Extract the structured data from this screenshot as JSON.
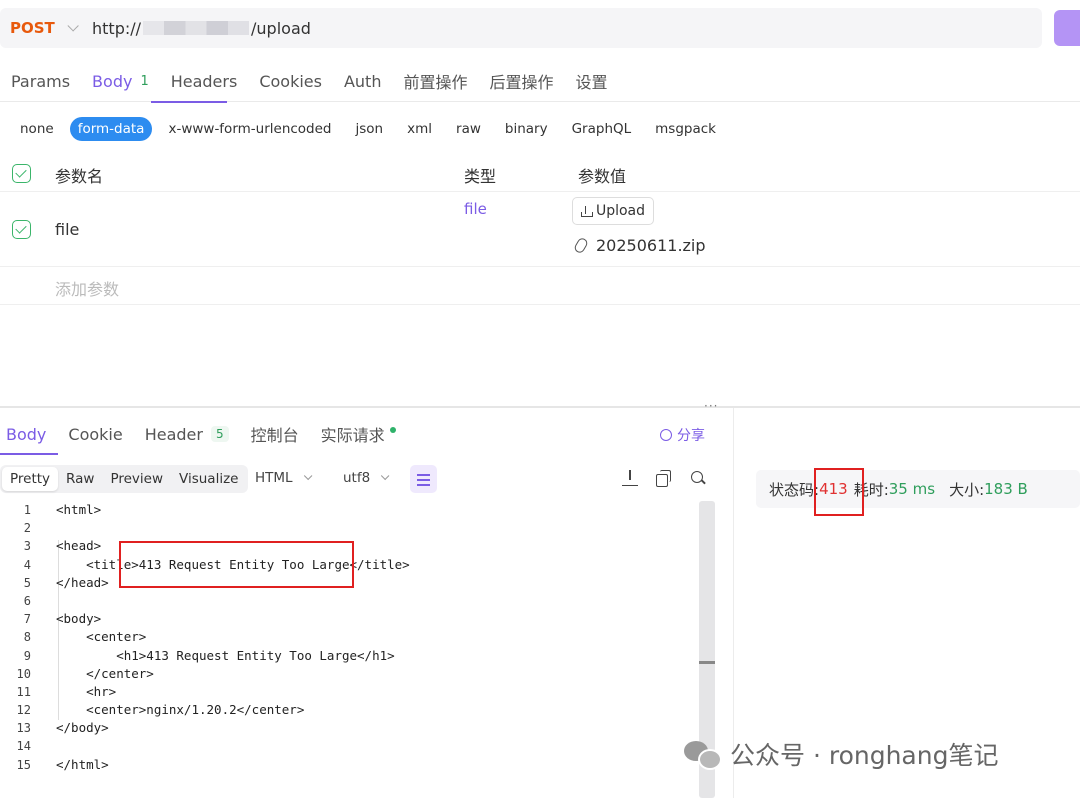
{
  "request": {
    "method": "POST",
    "url_prefix": "http://",
    "url_suffix": "/upload"
  },
  "tabs": [
    {
      "label": "Params"
    },
    {
      "label": "Body",
      "badge": "1"
    },
    {
      "label": "Headers"
    },
    {
      "label": "Cookies"
    },
    {
      "label": "Auth"
    },
    {
      "label": "前置操作"
    },
    {
      "label": "后置操作"
    },
    {
      "label": "设置"
    }
  ],
  "body_types": [
    "none",
    "form-data",
    "x-www-form-urlencoded",
    "json",
    "xml",
    "raw",
    "binary",
    "GraphQL",
    "msgpack"
  ],
  "params": {
    "headers": {
      "name": "参数名",
      "type": "类型",
      "value": "参数值"
    },
    "row": {
      "name": "file",
      "type": "file",
      "upload_label": "Upload",
      "filename": "20250611.zip"
    },
    "add_placeholder": "添加参数"
  },
  "grip": "···",
  "response_tabs": [
    {
      "label": "Body"
    },
    {
      "label": "Cookie"
    },
    {
      "label": "Header",
      "badge": "5"
    },
    {
      "label": "控制台"
    },
    {
      "label": "实际请求"
    }
  ],
  "share_label": "分享",
  "view_modes": [
    "Pretty",
    "Raw",
    "Preview",
    "Visualize"
  ],
  "format": "HTML",
  "encoding": "utf8",
  "code_lines": [
    {
      "n": "1",
      "t": "<html>"
    },
    {
      "n": "2",
      "t": ""
    },
    {
      "n": "3",
      "t": "<head>"
    },
    {
      "n": "4",
      "t": "    <title>413 Request Entity Too Large</title>"
    },
    {
      "n": "5",
      "t": "</head>"
    },
    {
      "n": "6",
      "t": ""
    },
    {
      "n": "7",
      "t": "<body>"
    },
    {
      "n": "8",
      "t": "    <center>"
    },
    {
      "n": "9",
      "t": "        <h1>413 Request Entity Too Large</h1>"
    },
    {
      "n": "10",
      "t": "    </center>"
    },
    {
      "n": "11",
      "t": "    <hr>"
    },
    {
      "n": "12",
      "t": "    <center>nginx/1.20.2</center>"
    },
    {
      "n": "13",
      "t": "</body>"
    },
    {
      "n": "14",
      "t": ""
    },
    {
      "n": "15",
      "t": "</html>"
    }
  ],
  "status": {
    "code_label": "状态码: ",
    "code": "413",
    "time_label": "耗时: ",
    "time": "35 ms",
    "size_label": "大小: ",
    "size": "183 B"
  },
  "watermark": "公众号 · ronghang笔记"
}
